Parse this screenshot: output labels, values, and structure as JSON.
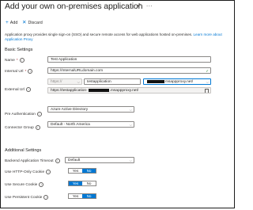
{
  "header": {
    "title": "Add your own on-premises application",
    "pin_icon": "pin-icon",
    "more_label": "..."
  },
  "toolbar": {
    "add_label": "Add",
    "discard_label": "Discard"
  },
  "description": {
    "text": "Application proxy provides single sign-on (SSO) and secure remote access for web applications hosted on-premises. ",
    "link": "Learn more about Application Proxy"
  },
  "basic_settings": {
    "heading": "Basic Settings",
    "name": {
      "label": "Name",
      "value": "Test Application"
    },
    "internal_url": {
      "label": "Internal Url",
      "value": "https://InternalURLdomain.com"
    },
    "external_url": {
      "label": "External Url",
      "protocol": "https://",
      "subdomain": "testapplication",
      "domain_suffix": "msappproxy.net/",
      "full_prefix": "https://testapplication-",
      "full_suffix": ".msappproxy.net/"
    },
    "pre_auth": {
      "label": "Pre Authentication",
      "value": "Azure Active Directory"
    },
    "connector_group": {
      "label": "Connector Group",
      "value": "Default - North America"
    }
  },
  "additional_settings": {
    "heading": "Additional Settings",
    "timeout": {
      "label": "Backend Application Timeout",
      "value": "Default"
    },
    "http_only": {
      "label": "Use HTTP-Only Cookie",
      "yes": "Yes",
      "no": "No",
      "selected": "No"
    },
    "secure": {
      "label": "Use Secure Cookie",
      "yes": "Yes",
      "no": "No",
      "selected": "Yes"
    },
    "persistent": {
      "label": "Use Persistent Cookie",
      "yes": "Yes",
      "no": "No",
      "selected": "No"
    }
  },
  "colors": {
    "accent": "#0078d4",
    "required": "#a4262c"
  }
}
